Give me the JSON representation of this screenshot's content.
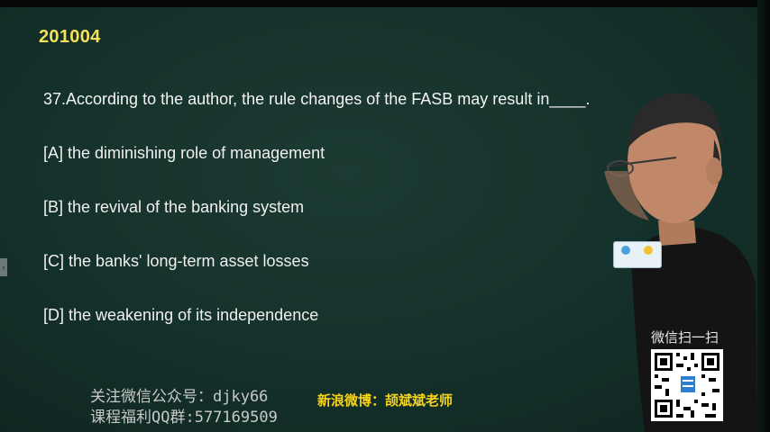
{
  "exam_code": "201004",
  "question": "37.According to the author, the rule changes of the FASB may result in____.",
  "options": [
    "[A] the diminishing role of management",
    "[B] the revival of the banking system",
    "[C] the banks' long-term asset losses",
    "[D] the weakening of its independence"
  ],
  "footer": {
    "line1": "关注微信公众号：djky66",
    "line2": "课程福利QQ群:577169509",
    "weibo": "新浪微博：颉斌斌老师"
  },
  "wechat_label": "微信扫一扫",
  "colors": {
    "board": "#15302a",
    "code": "#f2e15a",
    "weibo": "#f6d51c"
  }
}
